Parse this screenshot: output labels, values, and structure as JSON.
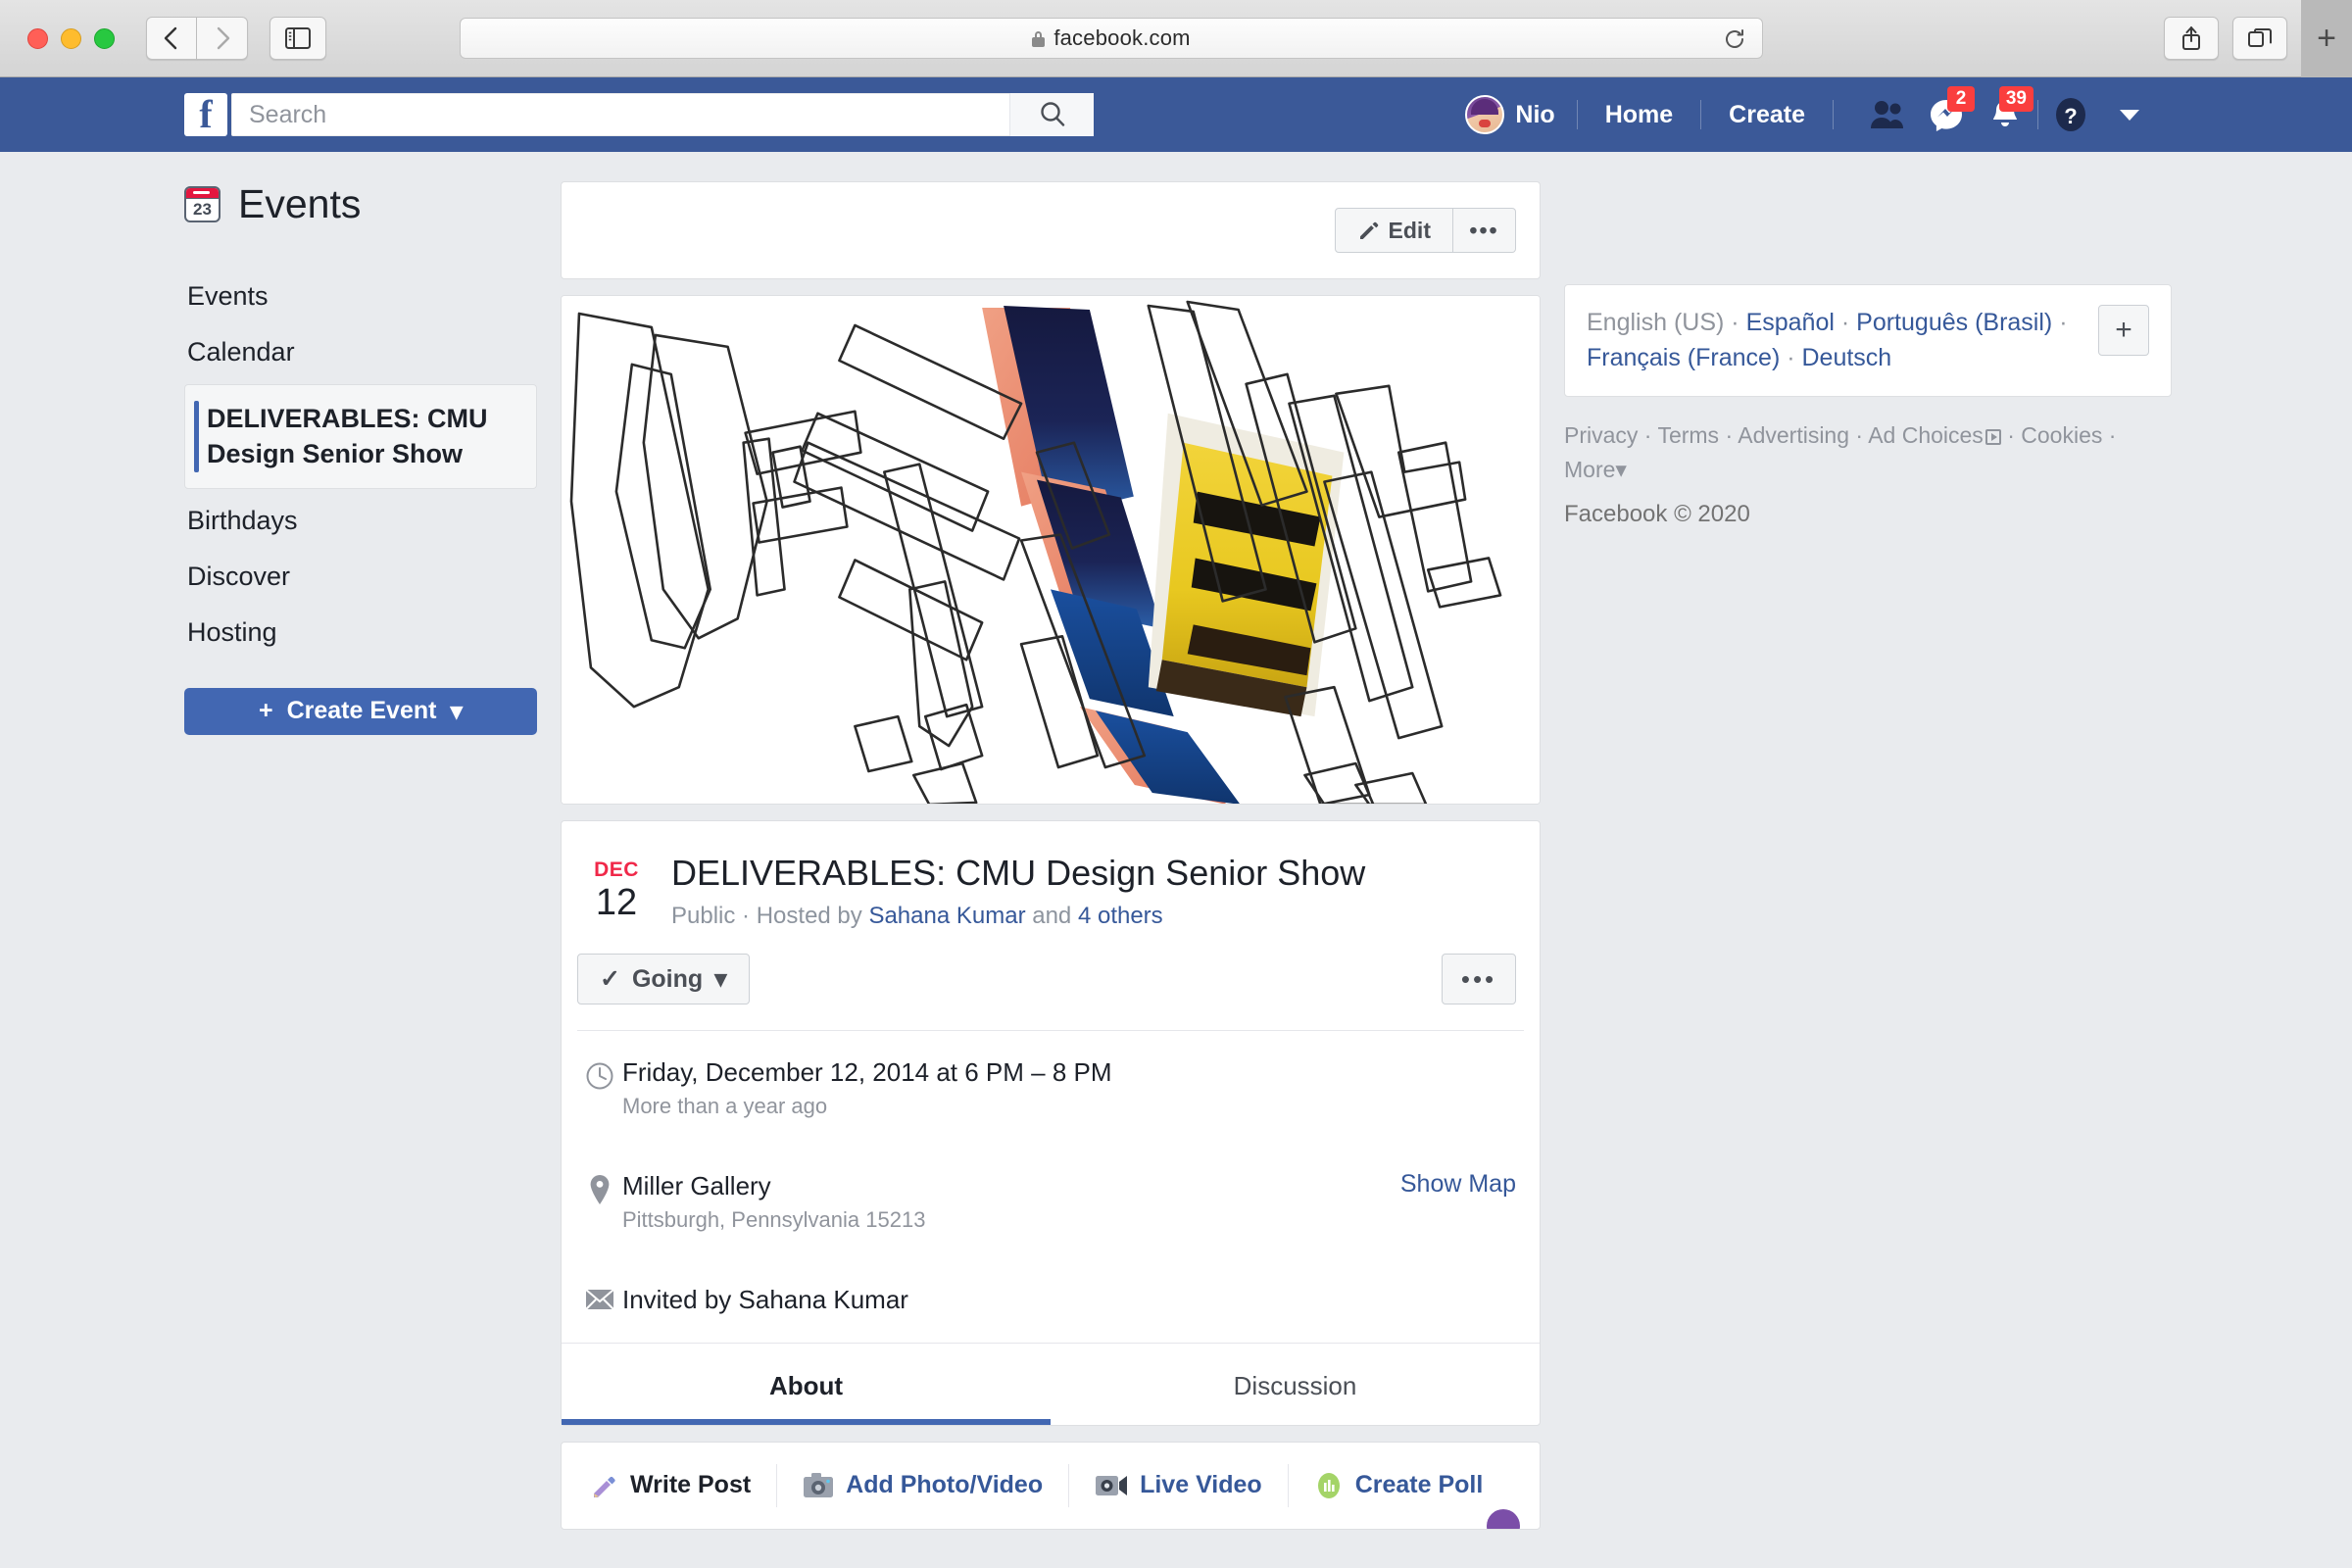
{
  "browser": {
    "url": "facebook.com",
    "back_label": "‹",
    "forward_label": "›",
    "sidebar_icon": "sidebar-icon",
    "reload_icon": "reload-icon",
    "share_icon": "share-icon",
    "tabs_icon": "tabs-overview-icon",
    "newtab_label": "+"
  },
  "navbar": {
    "logo": "f",
    "search_placeholder": "Search",
    "search_value": "",
    "search_icon": "search-icon",
    "username": "Nio",
    "home_label": "Home",
    "create_label": "Create",
    "friend_requests_icon": "friend-requests-icon",
    "messages_icon": "messenger-icon",
    "messages_badge": "2",
    "notifications_icon": "notifications-bell-icon",
    "notifications_badge": "39",
    "help_icon": "help-question-icon",
    "account_caret": "chevron-down-icon"
  },
  "sidebar": {
    "calendar_icon_day": "23",
    "title": "Events",
    "items": [
      {
        "label": "Events",
        "active": false
      },
      {
        "label": "Calendar",
        "active": false
      },
      {
        "label": "DELIVERABLES: CMU Design Senior Show",
        "active": true
      },
      {
        "label": "Birthdays",
        "active": false
      },
      {
        "label": "Discover",
        "active": false
      },
      {
        "label": "Hosting",
        "active": false
      }
    ],
    "create_event_label": "Create Event",
    "create_event_plus": "+",
    "create_event_caret": "▾"
  },
  "event": {
    "edit_label": "Edit",
    "edit_icon": "pencil-icon",
    "more_label": "•••",
    "cover_alt": "abstract typographic artwork with outlined letterforms and colorful poster fragments",
    "date_month": "DEC",
    "date_day": "12",
    "title": "DELIVERABLES: CMU Design Senior Show",
    "privacy": "Public",
    "hosted_by_prefix": "Hosted by",
    "host": "Sahana Kumar",
    "and_label": "and",
    "others": "4 others",
    "rsvp_label": "Going",
    "rsvp_check": "✓",
    "rsvp_caret": "▾",
    "rsvp_more": "•••",
    "time_icon": "clock-icon",
    "time_title": "Friday, December 12, 2014 at 6 PM – 8 PM",
    "time_sub": "More than a year ago",
    "place_icon": "map-pin-icon",
    "place_title": "Miller Gallery",
    "place_sub": "Pittsburgh, Pennsylvania 15213",
    "show_map": "Show Map",
    "invite_icon": "envelope-icon",
    "invite_text": "Invited by Sahana Kumar",
    "tabs": [
      {
        "label": "About",
        "active": true
      },
      {
        "label": "Discussion",
        "active": false
      }
    ],
    "post_actions": [
      {
        "label": "Write Post",
        "icon": "pencil-icon"
      },
      {
        "label": "Add Photo/Video",
        "icon": "camera-icon"
      },
      {
        "label": "Live Video",
        "icon": "video-camera-icon"
      },
      {
        "label": "Create Poll",
        "icon": "poll-icon"
      }
    ]
  },
  "right_sidebar": {
    "languages": [
      {
        "label": "English (US)",
        "current": true
      },
      {
        "label": "Español",
        "current": false
      },
      {
        "label": "Português (Brasil)",
        "current": false
      },
      {
        "label": "Français (France)",
        "current": false
      },
      {
        "label": "Deutsch",
        "current": false
      }
    ],
    "add_language": "+",
    "footer_links": [
      "Privacy",
      "Terms",
      "Advertising",
      "Ad Choices",
      "Cookies",
      "More"
    ],
    "more_caret": "▾",
    "copyright": "Facebook © 2020"
  },
  "colors": {
    "fb_blue": "#3b5998",
    "accent_blue": "#4267b2",
    "link_blue": "#365899",
    "page_bg": "#e9ebee",
    "badge_red": "#fa3e3e",
    "date_red": "#f02849"
  }
}
